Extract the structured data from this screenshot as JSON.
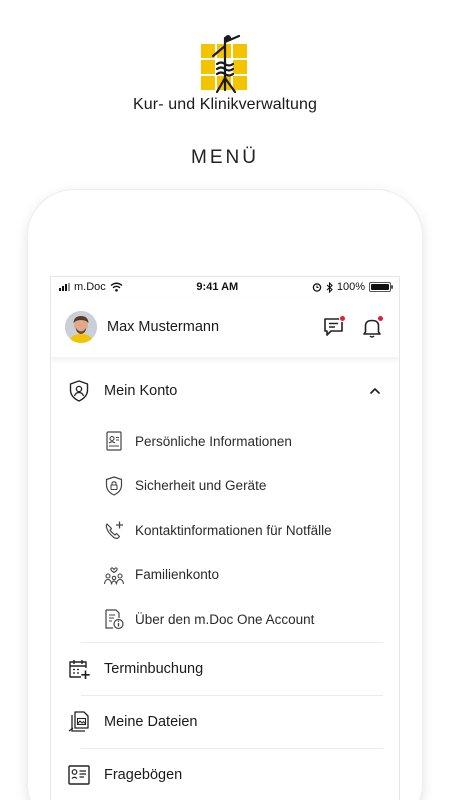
{
  "brand": {
    "name": "Kur- und Klinikverwaltung",
    "logo_colors": {
      "yellow": "#f5c400",
      "black": "#1a1a1a"
    }
  },
  "page": {
    "title": "MENÜ"
  },
  "statusbar": {
    "carrier": "m.Doc",
    "time": "9:41 AM",
    "battery": "100%",
    "battery_level": 1.0
  },
  "user": {
    "name": "Max Mustermann",
    "icons": [
      "avatar",
      "chat-icon",
      "bell-icon"
    ],
    "notification_color": "#e0203a"
  },
  "menu": {
    "account": {
      "label": "Mein Konto",
      "expanded": true,
      "items": [
        {
          "label": "Persönliche Informationen",
          "icon": "id-card-icon"
        },
        {
          "label": "Sicherheit und Geräte",
          "icon": "shield-lock-icon"
        },
        {
          "label": "Kontaktinformationen für Notfälle",
          "icon": "phone-plus-icon"
        },
        {
          "label": "Familienkonto",
          "icon": "family-icon"
        },
        {
          "label": "Über den m.Doc One Account",
          "icon": "info-document-icon"
        }
      ]
    },
    "items": [
      {
        "label": "Terminbuchung",
        "icon": "calendar-plus-icon"
      },
      {
        "label": "Meine Dateien",
        "icon": "files-icon"
      },
      {
        "label": "Fragebögen",
        "icon": "questionnaire-icon"
      }
    ]
  }
}
